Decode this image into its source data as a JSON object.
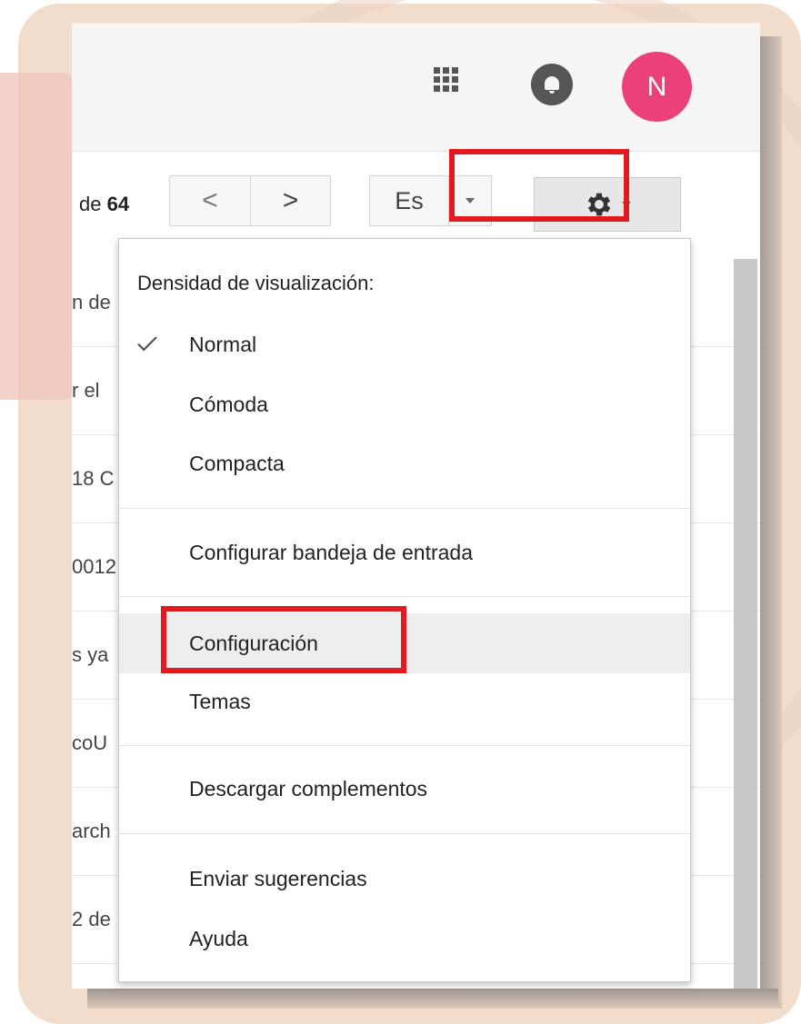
{
  "header": {
    "avatar_initial": "N",
    "apps_icon": "apps-grid-icon",
    "notifications_icon": "bell-icon",
    "avatar_color": "#ec407a"
  },
  "toolbar": {
    "page_count_prefix": "de",
    "page_count_total": "64",
    "prev_icon": "<",
    "next_icon": ">",
    "language_label": "Es",
    "settings_icon": "gear-icon"
  },
  "email_list": {
    "rows": [
      {
        "snippet": "n de"
      },
      {
        "snippet": "r el"
      },
      {
        "snippet": "18 C"
      },
      {
        "snippet": "0012"
      },
      {
        "snippet": "s ya"
      },
      {
        "snippet": "coU"
      },
      {
        "snippet": "arch"
      },
      {
        "snippet": "2 de"
      }
    ]
  },
  "settings_menu": {
    "density_heading": "Densidad de visualización:",
    "density_options": [
      {
        "label": "Normal",
        "checked": true
      },
      {
        "label": "Cómoda",
        "checked": false
      },
      {
        "label": "Compacta",
        "checked": false
      }
    ],
    "configure_inbox": "Configurar bandeja de entrada",
    "settings": "Configuración",
    "themes": "Temas",
    "download_addons": "Descargar complementos",
    "send_feedback": "Enviar sugerencias",
    "help": "Ayuda"
  },
  "highlight_color": "#e2191f"
}
